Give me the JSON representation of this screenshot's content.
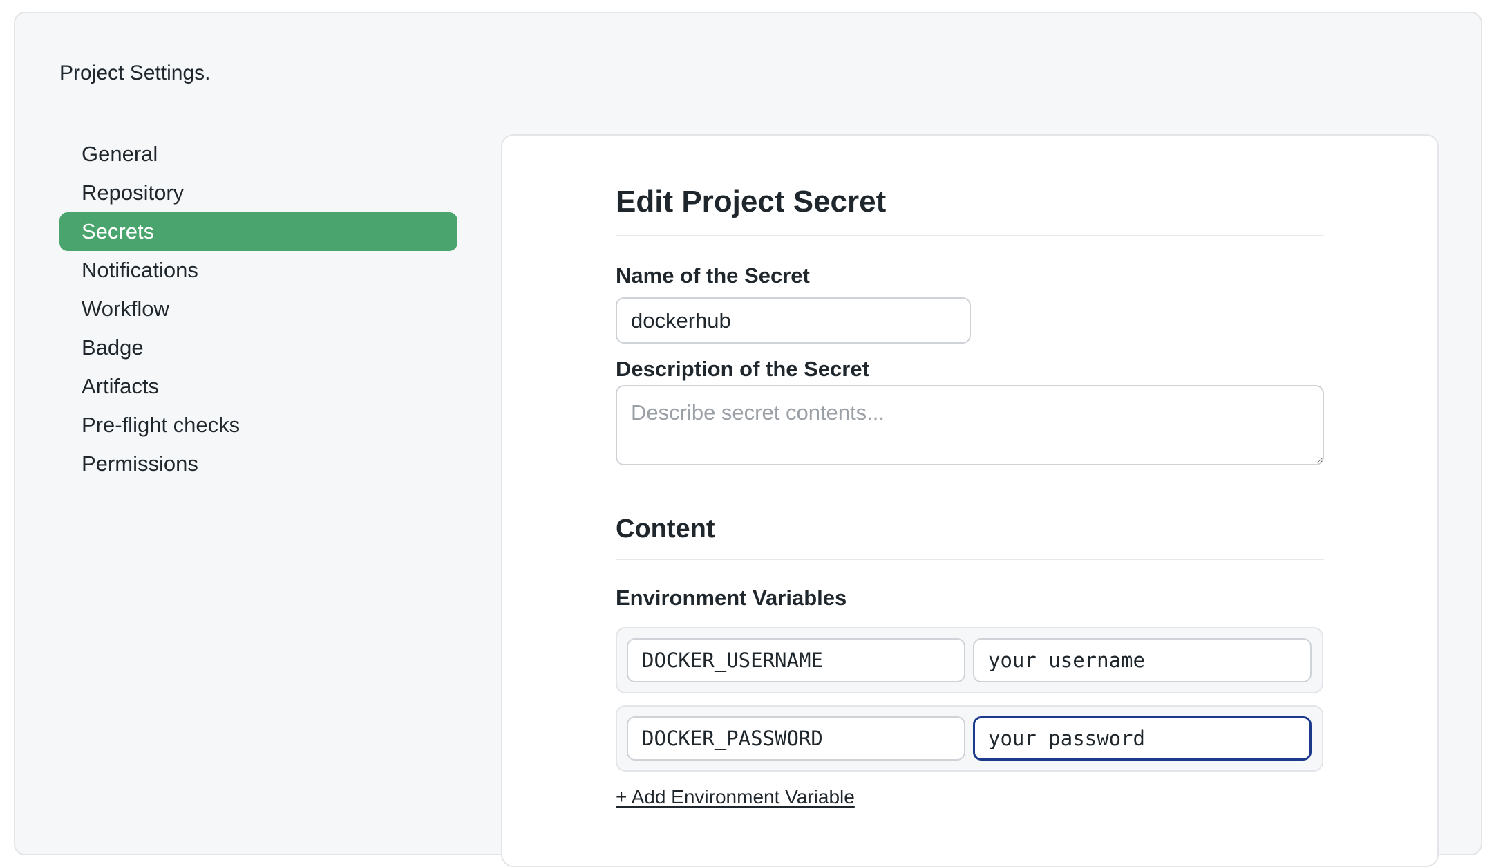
{
  "page": {
    "title": "Project Settings."
  },
  "sidebar": {
    "items": [
      {
        "label": "General",
        "active": false
      },
      {
        "label": "Repository",
        "active": false
      },
      {
        "label": "Secrets",
        "active": true
      },
      {
        "label": "Notifications",
        "active": false
      },
      {
        "label": "Workflow",
        "active": false
      },
      {
        "label": "Badge",
        "active": false
      },
      {
        "label": "Artifacts",
        "active": false
      },
      {
        "label": "Pre-flight checks",
        "active": false
      },
      {
        "label": "Permissions",
        "active": false
      }
    ],
    "active_color": "#4aa46e"
  },
  "form": {
    "heading": "Edit Project Secret",
    "name_label": "Name of the Secret",
    "name_value": "dockerhub",
    "description_label": "Description of the Secret",
    "description_value": "",
    "description_placeholder": "Describe secret contents...",
    "content_heading": "Content",
    "env_label": "Environment Variables",
    "env_vars": [
      {
        "key": "DOCKER_USERNAME",
        "value": "your username",
        "focused": false
      },
      {
        "key": "DOCKER_PASSWORD",
        "value": "your password",
        "focused": true
      }
    ],
    "add_env_link": "+ Add Environment Variable",
    "focus_color": "#1c3a8c"
  }
}
